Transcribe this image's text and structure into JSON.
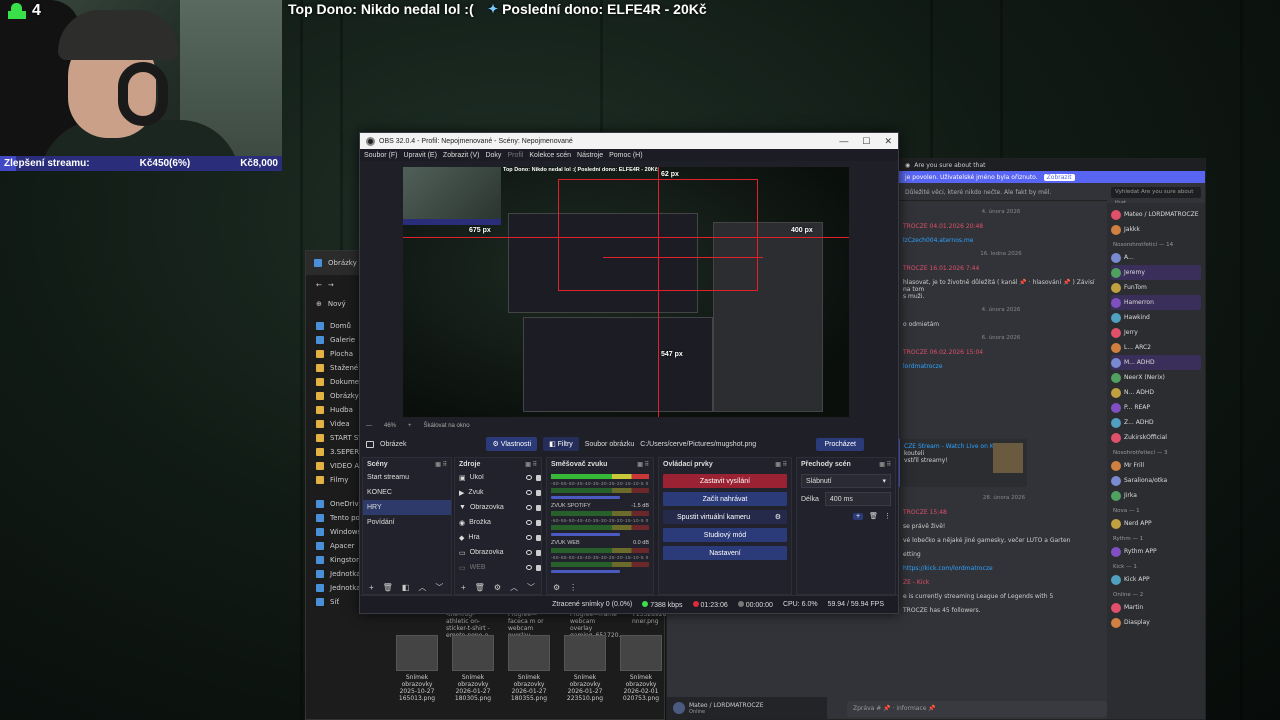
{
  "overlay": {
    "viewer_count": "4",
    "goal_label": "Zlepšení streamu:",
    "goal_current": "Kč450(6%)",
    "goal_target": "Kč8,000",
    "goal_progress": 0.0563,
    "top_donor": "Top Dono: Nikdo nedal lol :(",
    "last_donor": "Poslední dono: ELFE4R - 20Kč"
  },
  "obs": {
    "title": "OBS 32.0.4 - Profil: Nepojmenované - Scény: Nepojmenované",
    "menu": [
      "Soubor (F)",
      "Upravit (E)",
      "Zobrazit (V)",
      "Doky",
      "Profil",
      "Kolekce scén",
      "Nástroje",
      "Pomoc (H)"
    ],
    "preview": {
      "measure_top": "62 px",
      "measure_left": "675 px",
      "measure_right": "400 px",
      "measure_bottom": "547 px",
      "mini_top_text": "Top Dono: Nikdo nedal lol :(      Poslední dono: ELFE4R - 20Kč"
    },
    "zoom": "46%",
    "scale_mode": "Škálovat na okno",
    "source_bar": {
      "source_name": "Obrázek",
      "properties": "Vlastnosti",
      "filters": "Filtry",
      "file_label": "Soubor obrázku",
      "file_path": "C:/Users/cerve/Pictures/mugshot.png",
      "browse": "Procházet"
    },
    "scenes": {
      "title": "Scény",
      "items": [
        "Start streamu",
        "KONEC",
        "HRY",
        "Povídání"
      ],
      "selected_index": 2
    },
    "sources": {
      "title": "Zdroje",
      "items": [
        "Úkol",
        "Zvuk",
        "Obrazovka",
        "Brožka",
        "Hra",
        "Obrazovka",
        "WEB"
      ]
    },
    "mixer": {
      "title": "Směšovač zvuku",
      "channels": [
        {
          "name": "",
          "db": ""
        },
        {
          "name": "ZVUK SPOTIFY",
          "db": "-1.5 dB"
        },
        {
          "name": "ZVUK WEB",
          "db": "0.0 dB"
        }
      ],
      "scale": "-60-55-50-45-40-35-30-25-20-15-10-5 0"
    },
    "controls": {
      "title": "Ovládací prvky",
      "stop_stream": "Zastavit vysílání",
      "start_record": "Začít nahrávat",
      "virtual_cam": "Spustit virtuální kameru",
      "studio_mode": "Studiový mód",
      "settings": "Nastavení"
    },
    "transitions": {
      "title": "Přechody scén",
      "selected": "Slábnutí",
      "duration_label": "Délka",
      "duration": "400 ms"
    },
    "status": {
      "dropped_frames": "Ztracené snímky 0 (0.0%)",
      "bitrate": "7388 kbps",
      "stream_time": "01:23:06",
      "record_time": "00:00:00",
      "cpu": "CPU: 6.0%",
      "fps": "59.94 / 59.94 FPS"
    }
  },
  "explorer": {
    "tab": "Obrázky",
    "new_label": "Nový",
    "nav_items": [
      "Domů",
      "Galerie",
      "Plocha",
      "Stažené so",
      "Dokument",
      "Obrázky",
      "Hudba",
      "Videa",
      "START STR",
      "3.SEPERAT",
      "VIDEO ALL",
      "Filmy"
    ],
    "tree": [
      "OneDrive",
      "Tento poč",
      "Windows",
      "Apacer",
      "Kingston 980GB (",
      "Jednotka DVD (F:)",
      "Jednotka DVD (F:) C",
      "Síť"
    ],
    "top_files": [
      "-the-frog-athletic on-sticker-t-shirt -emote-pepe-e...",
      "Progree—faceca m or webcam overlay black_6...",
      "Progree—frame webcam overlay gaming_651720...",
      "713528926ha nner.png"
    ],
    "thumbs": [
      "Snímek obrazovky 2025-10-27 165013.png",
      "Snímek obrazovky 2026-01-27 180305.png",
      "Snímek obrazovky 2026-01-27 180355.png",
      "Snímek obrazovky 2026-01-27 223510.png",
      "Snímek obrazovky 2026-02-01 020753.png"
    ]
  },
  "discord": {
    "window_title": "Are you sure about that",
    "notice": "je povolen. Uživatelské jméno byla ořiznuto.",
    "notice_button": "Zobrazit",
    "channel_topic": "Důležité věci, které nikdo nečte. Ale fakt by měl.",
    "search_placeholder": "Vyhledat Are you sure about that",
    "chat": [
      {
        "kind": "date",
        "text": "4. února 2026"
      },
      {
        "kind": "name",
        "text": "TROCZE  04.01.2026 20:48"
      },
      {
        "kind": "link",
        "text": "lzCzech004.aternos.me"
      },
      {
        "kind": "date",
        "text": "16. ledna 2026"
      },
      {
        "kind": "name",
        "text": "TROCZE  16.01.2026 7:44"
      },
      {
        "kind": "text",
        "text": "hlasovat, je to životně důležitá ( kanál 📌 · hlasování 📌 ) Závisí na tom"
      },
      {
        "kind": "text",
        "text": "s muži."
      },
      {
        "kind": "date",
        "text": "4. února 2026"
      },
      {
        "kind": "text",
        "text": "o odmietám"
      },
      {
        "kind": "date",
        "text": "6. února 2026"
      },
      {
        "kind": "name",
        "text": "TROCZE  06.02.2026 15:04"
      },
      {
        "kind": "link",
        "text": "lordmatrocze"
      }
    ],
    "embed_title": "CZE Stream - Watch Live on Kick",
    "embed_text": "kouteli",
    "embed_text2": "vstříl streamy!",
    "chat2": [
      {
        "kind": "date",
        "text": "28. února 2026"
      },
      {
        "kind": "name",
        "text": "TROCZE  15:48"
      },
      {
        "kind": "text",
        "text": "se právě živě!"
      },
      {
        "kind": "text",
        "text": "vé lobečko a nějaké jiné gamesky, večer LUTO a Garten"
      },
      {
        "kind": "text",
        "text": "etting"
      },
      {
        "kind": "link",
        "text": "https://kick.com/lordmatrocze"
      },
      {
        "kind": "name",
        "text": "ZE - Kick"
      },
      {
        "kind": "text",
        "text": "e is currently streaming League of Legends with 5"
      },
      {
        "kind": "text",
        "text": "TROCZE has 45 followers."
      }
    ],
    "members": [
      {
        "section": "",
        "name": "Mateo / LORDMATROCZE"
      },
      {
        "section": "",
        "name": "Jakkk"
      },
      {
        "section": "Nosorohrotřeticí — 14",
        "name": "A..."
      },
      {
        "section": "",
        "name": "Jeremy"
      },
      {
        "section": "",
        "name": "FunTom"
      },
      {
        "section": "",
        "name": "Hamerron"
      },
      {
        "section": "",
        "name": "Hawkind"
      },
      {
        "section": "",
        "name": "Jerry"
      },
      {
        "section": "",
        "name": "L... ARC2"
      },
      {
        "section": "",
        "name": "M... ADHD"
      },
      {
        "section": "",
        "name": "NeerX (Nerix)"
      },
      {
        "section": "",
        "name": "N... ADHD"
      },
      {
        "section": "",
        "name": "P... REAP"
      },
      {
        "section": "",
        "name": "Z... ADHD"
      },
      {
        "section": "",
        "name": "ZukirskOfficial"
      },
      {
        "section": "Nosohrotřetiecí — 3",
        "name": "Mr Frill"
      },
      {
        "section": "",
        "name": "Saraliona/otka"
      },
      {
        "section": "",
        "name": "Jirka"
      },
      {
        "section": "Nova — 1",
        "name": "Nerd APP"
      },
      {
        "section": "Rythm — 1",
        "name": "Rythm APP"
      },
      {
        "section": "Kick — 1",
        "name": "Kick APP"
      },
      {
        "section": "Online — 2",
        "name": "Martin"
      },
      {
        "section": "",
        "name": "Diasplay"
      }
    ],
    "user_name": "Mateo / LORDMATROCZE",
    "user_status": "Online",
    "input_placeholder": "Zpráva # 📌 · informace 📌"
  }
}
